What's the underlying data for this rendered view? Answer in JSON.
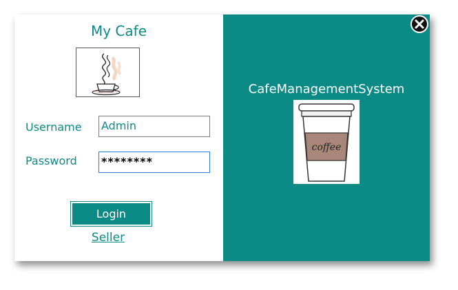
{
  "app": {
    "title": "My Cafe"
  },
  "login_form": {
    "username_label": "Username",
    "username_value": "Admin",
    "password_label": "Password",
    "password_value": "********",
    "login_button": "Login",
    "seller_link": "Seller"
  },
  "brand_panel": {
    "system_title": "CafeManagementSystem",
    "cup_text": "coffee"
  },
  "colors": {
    "accent": "#0b8a86",
    "background": "#ffffff",
    "close_button": "#111111"
  },
  "icons": {
    "close": "close-icon",
    "steaming_cup": "steaming-cup-icon",
    "coffee_cup": "coffee-cup-icon"
  }
}
